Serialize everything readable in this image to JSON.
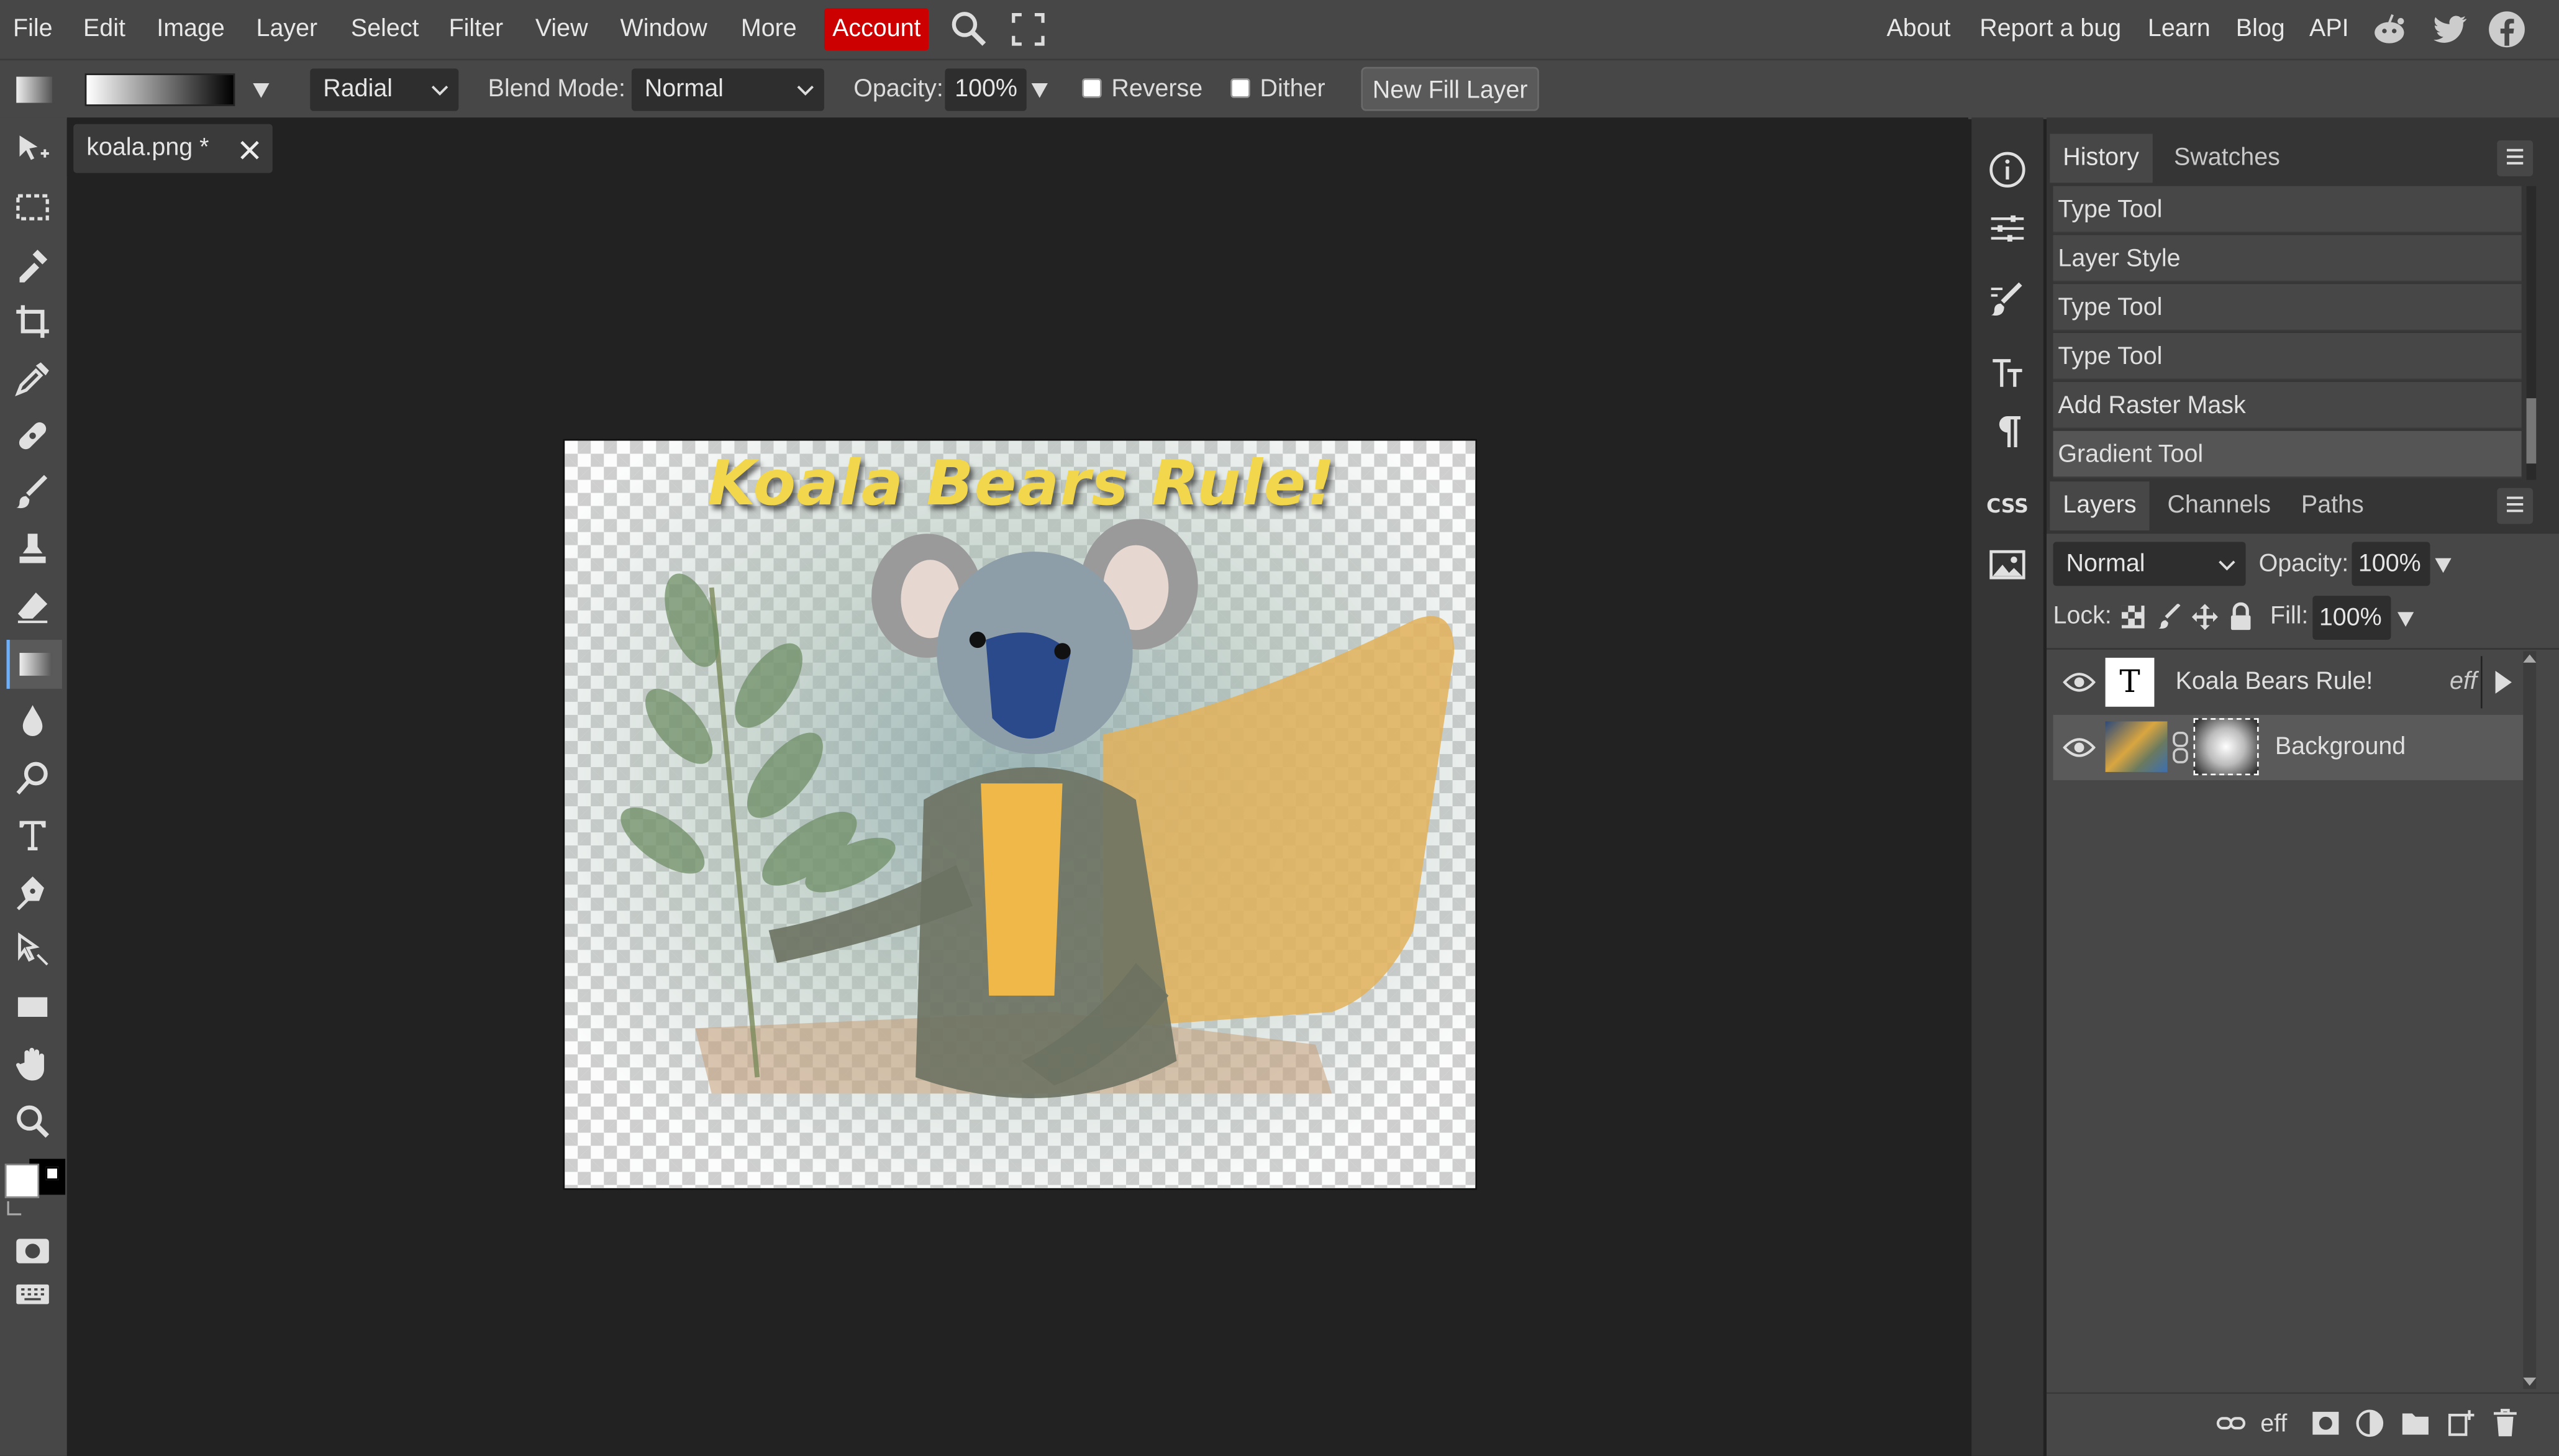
{
  "menubar": {
    "items": [
      "File",
      "Edit",
      "Image",
      "Layer",
      "Select",
      "Filter",
      "View",
      "Window",
      "More"
    ],
    "account": "Account",
    "right_links": [
      "About",
      "Report a bug",
      "Learn",
      "Blog",
      "API"
    ],
    "social_icons": [
      "reddit-icon",
      "twitter-icon",
      "facebook-icon"
    ]
  },
  "options": {
    "gradient_type": "Radial",
    "blend_mode_label": "Blend Mode:",
    "blend_mode": "Normal",
    "opacity_label": "Opacity:",
    "opacity": "100%",
    "reverse_label": "Reverse",
    "dither_label": "Dither",
    "new_fill_layer": "New Fill Layer"
  },
  "document": {
    "tab_title": "koala.png *",
    "text_layer": "Koala Bears Rule!"
  },
  "history": {
    "tabs": [
      "History",
      "Swatches"
    ],
    "items": [
      "Type Tool",
      "Layer Style",
      "Type Tool",
      "Type Tool",
      "Add Raster Mask",
      "Gradient Tool"
    ]
  },
  "layers": {
    "tabs": [
      "Layers",
      "Channels",
      "Paths"
    ],
    "blend_mode": "Normal",
    "opacity_label": "Opacity:",
    "opacity": "100%",
    "lock_label": "Lock:",
    "fill_label": "Fill:",
    "fill": "100%",
    "items": [
      {
        "name": "Koala Bears Rule!",
        "thumb": "T",
        "badge": "eff"
      },
      {
        "name": "Background"
      }
    ],
    "footer_eff": "eff"
  },
  "collapse_left": "<>",
  "collapse_right": "><",
  "colors": {
    "account_bg": "#cc0000",
    "ui_bg": "#474747",
    "workspace_bg": "#222222",
    "text_yellow": "#f2d64b"
  }
}
